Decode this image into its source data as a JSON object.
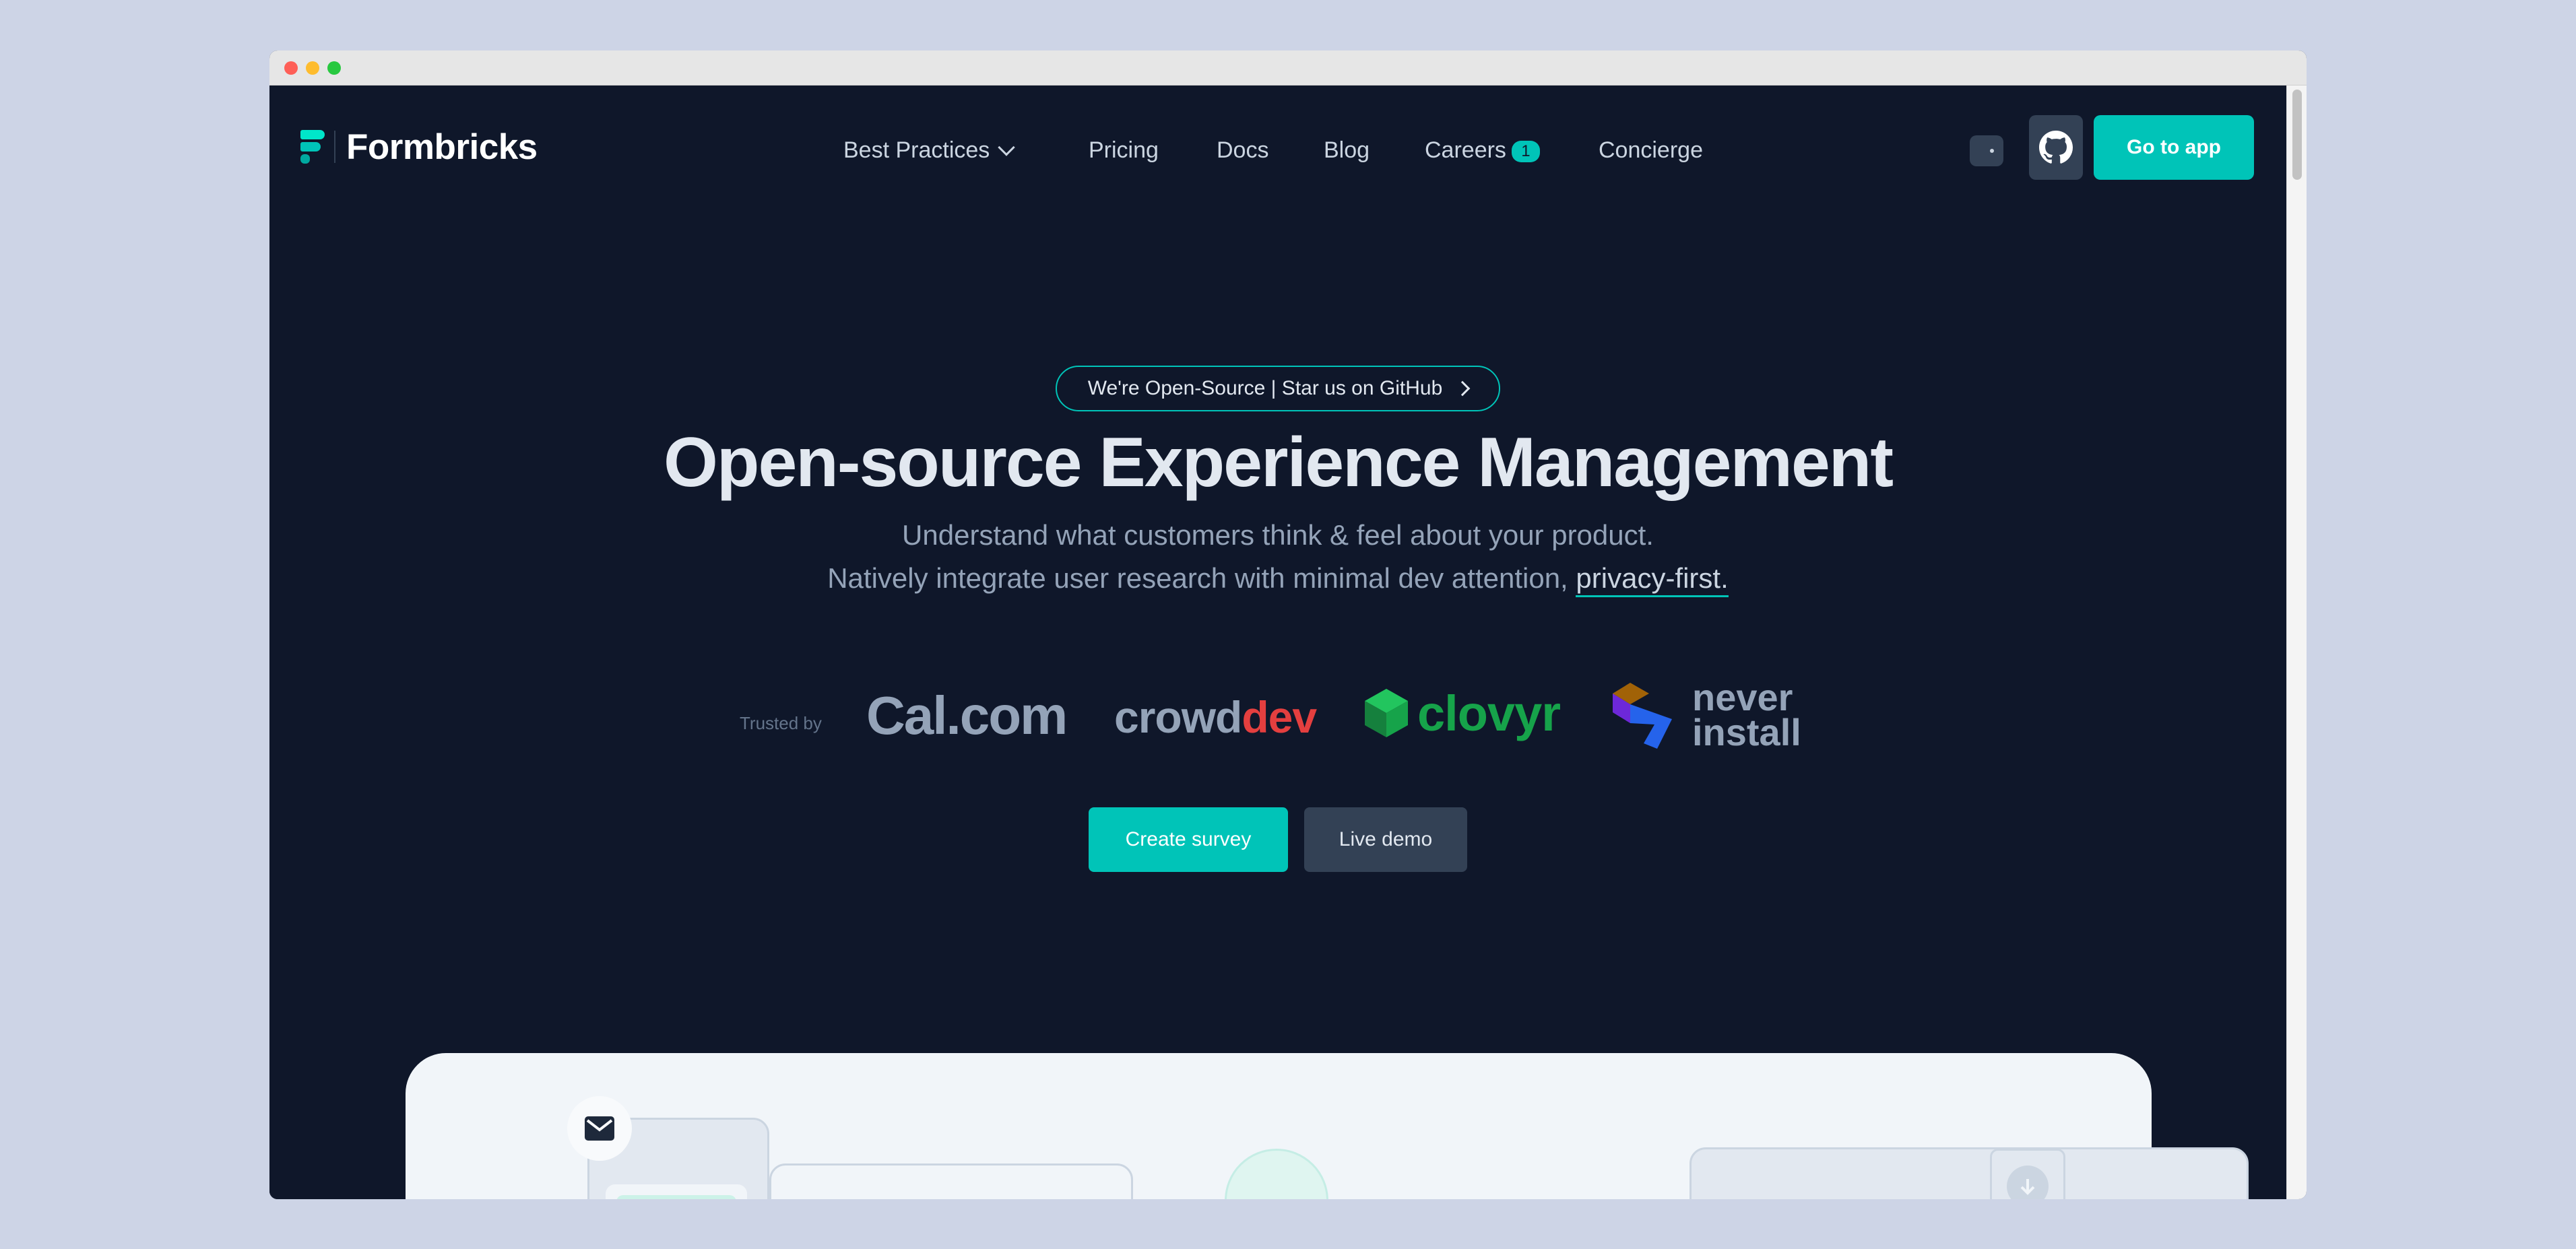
{
  "nav": {
    "brand": "Formbricks",
    "items": [
      {
        "label": "Best Practices"
      },
      {
        "label": "Pricing"
      },
      {
        "label": "Docs"
      },
      {
        "label": "Blog"
      },
      {
        "label": "Careers",
        "badge": "1"
      },
      {
        "label": "Concierge"
      }
    ],
    "theme_toggle_icon": "moon-icon",
    "github_icon": "github-icon",
    "go_to_app": "Go to app"
  },
  "hero": {
    "pill": "We're Open-Source | Star us on GitHub",
    "title": "Open-source Experience Management",
    "subtitle_line1": "Understand what customers think & feel about your product.",
    "subtitle_line2_prefix": "Natively integrate user research with minimal dev attention, ",
    "subtitle_line2_link": "privacy-first.",
    "trusted_by": "Trusted by",
    "logos": {
      "cal": "Cal.com",
      "crowd_a": "crowd",
      "crowd_b": "dev",
      "clovyr": "clovyr",
      "never_1": "never",
      "never_2": "install"
    },
    "create_survey": "Create survey",
    "live_demo": "Live demo"
  },
  "colors": {
    "background": "#0f172a",
    "accent": "#00c4b8",
    "card": "#f1f5f9"
  }
}
